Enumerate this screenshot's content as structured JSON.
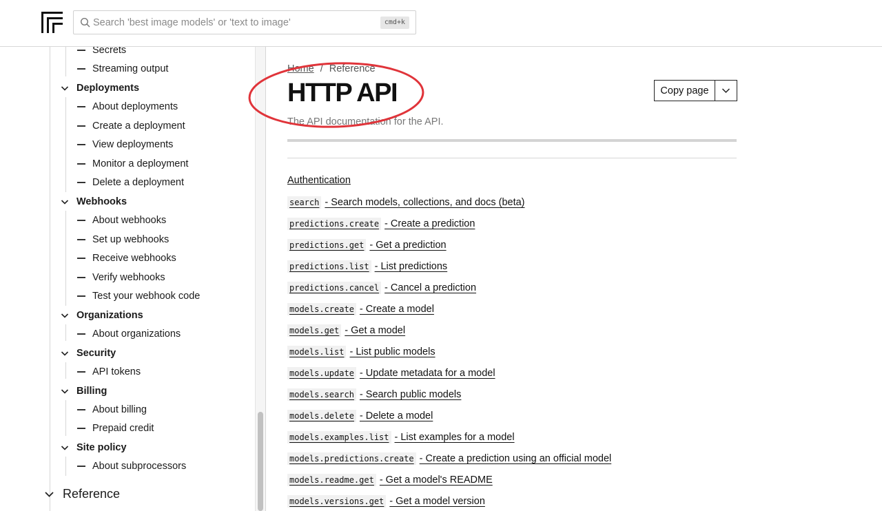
{
  "header": {
    "search_placeholder": "Search 'best image models' or 'text to image'",
    "shortcut": "cmd+k"
  },
  "sidebar": {
    "top_items": [
      "Secrets",
      "Streaming output"
    ],
    "groups": [
      {
        "title": "Deployments",
        "items": [
          "About deployments",
          "Create a deployment",
          "View deployments",
          "Monitor a deployment",
          "Delete a deployment"
        ]
      },
      {
        "title": "Webhooks",
        "items": [
          "About webhooks",
          "Set up webhooks",
          "Receive webhooks",
          "Verify webhooks",
          "Test your webhook code"
        ]
      },
      {
        "title": "Organizations",
        "items": [
          "About organizations"
        ]
      },
      {
        "title": "Security",
        "items": [
          "API tokens"
        ]
      },
      {
        "title": "Billing",
        "items": [
          "About billing",
          "Prepaid credit"
        ]
      },
      {
        "title": "Site policy",
        "items": [
          "About subprocessors"
        ]
      }
    ],
    "reference_label": "Reference"
  },
  "breadcrumb": {
    "home": "Home",
    "separator": "/",
    "current": "Reference"
  },
  "page": {
    "title": "HTTP API",
    "subtitle": "The API documentation for the API.",
    "copy_label": "Copy page"
  },
  "content": {
    "auth_link": "Authentication",
    "endpoints": [
      {
        "code": "search",
        "desc": "- Search models, collections, and docs (beta)"
      },
      {
        "code": "predictions.create",
        "desc": "- Create a prediction"
      },
      {
        "code": "predictions.get",
        "desc": "- Get a prediction"
      },
      {
        "code": "predictions.list",
        "desc": "- List predictions"
      },
      {
        "code": "predictions.cancel",
        "desc": "- Cancel a prediction"
      },
      {
        "code": "models.create",
        "desc": "- Create a model"
      },
      {
        "code": "models.get",
        "desc": "- Get a model"
      },
      {
        "code": "models.list",
        "desc": "- List public models"
      },
      {
        "code": "models.update",
        "desc": "- Update metadata for a model"
      },
      {
        "code": "models.search",
        "desc": "- Search public models"
      },
      {
        "code": "models.delete",
        "desc": "- Delete a model"
      },
      {
        "code": "models.examples.list",
        "desc": "- List examples for a model"
      },
      {
        "code": "models.predictions.create",
        "desc": "- Create a prediction using an official model"
      },
      {
        "code": "models.readme.get",
        "desc": "- Get a model's README"
      },
      {
        "code": "models.versions.get",
        "desc": "- Get a model version"
      }
    ]
  },
  "colors": {
    "annotation_red": "#e0343a",
    "accent": "#111111"
  }
}
